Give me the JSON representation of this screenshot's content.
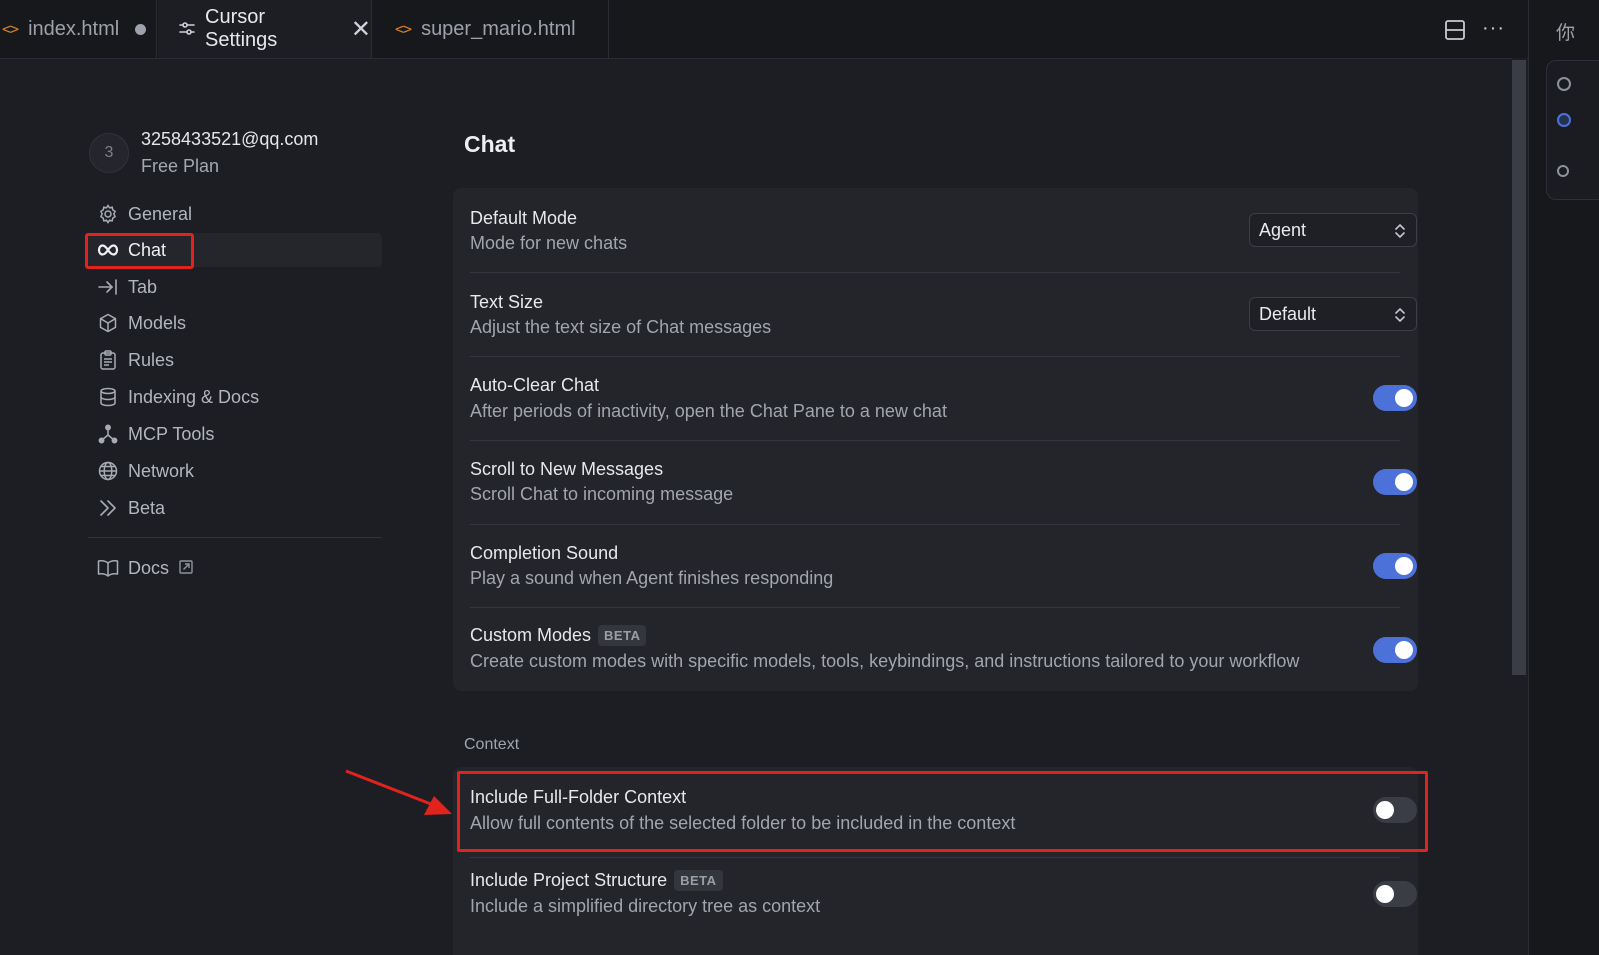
{
  "tabs": [
    {
      "label": "index.html",
      "icon": "code-icon",
      "modified": true
    },
    {
      "label": "Cursor Settings",
      "icon": "settings-sliders-icon",
      "active": true
    },
    {
      "label": "super_mario.html",
      "icon": "code-icon"
    }
  ],
  "toolbar_icons": [
    "split-editor-icon",
    "more-actions-icon"
  ],
  "right_strip": {
    "char": "你"
  },
  "account": {
    "avatar_initial": "3",
    "email": "3258433521@qq.com",
    "plan": "Free Plan"
  },
  "sidebar": {
    "items": [
      {
        "label": "General",
        "icon": "gear-icon"
      },
      {
        "label": "Chat",
        "icon": "infinity-icon",
        "active": true
      },
      {
        "label": "Tab",
        "icon": "tab-arrow-icon"
      },
      {
        "label": "Models",
        "icon": "cube-icon"
      },
      {
        "label": "Rules",
        "icon": "clipboard-icon"
      },
      {
        "label": "Indexing & Docs",
        "icon": "database-icon"
      },
      {
        "label": "MCP Tools",
        "icon": "nodes-icon"
      },
      {
        "label": "Network",
        "icon": "globe-icon"
      },
      {
        "label": "Beta",
        "icon": "double-chevron-icon"
      }
    ],
    "docs": {
      "label": "Docs",
      "icon": "book-icon",
      "external_icon": "external-link-icon"
    }
  },
  "main": {
    "title": "Chat",
    "chat_settings": [
      {
        "title": "Default Mode",
        "desc": "Mode for new chats",
        "control": "select",
        "value": "Agent"
      },
      {
        "title": "Text Size",
        "desc": "Adjust the text size of Chat messages",
        "control": "select",
        "value": "Default"
      },
      {
        "title": "Auto-Clear Chat",
        "desc": "After periods of inactivity, open the Chat Pane to a new chat",
        "control": "toggle",
        "on": true
      },
      {
        "title": "Scroll to New Messages",
        "desc": "Scroll Chat to incoming message",
        "control": "toggle",
        "on": true
      },
      {
        "title": "Completion Sound",
        "desc": "Play a sound when Agent finishes responding",
        "control": "toggle",
        "on": true
      },
      {
        "title": "Custom Modes",
        "badge": "BETA",
        "desc": "Create custom modes with specific models, tools, keybindings, and instructions tailored to your workflow",
        "control": "toggle",
        "on": true
      }
    ],
    "context_label": "Context",
    "context_settings": [
      {
        "title": "Include Full-Folder Context",
        "desc": "Allow full contents of the selected folder to be included in the context",
        "control": "toggle",
        "on": false
      },
      {
        "title": "Include Project Structure",
        "badge": "BETA",
        "desc": "Include a simplified directory tree as context",
        "control": "toggle",
        "on": false
      }
    ]
  },
  "colors": {
    "accent": "#4c72d9",
    "highlight": "#e0231c",
    "background": "#1c1e24",
    "card": "#23252b",
    "file_icon": "#d9822b"
  }
}
